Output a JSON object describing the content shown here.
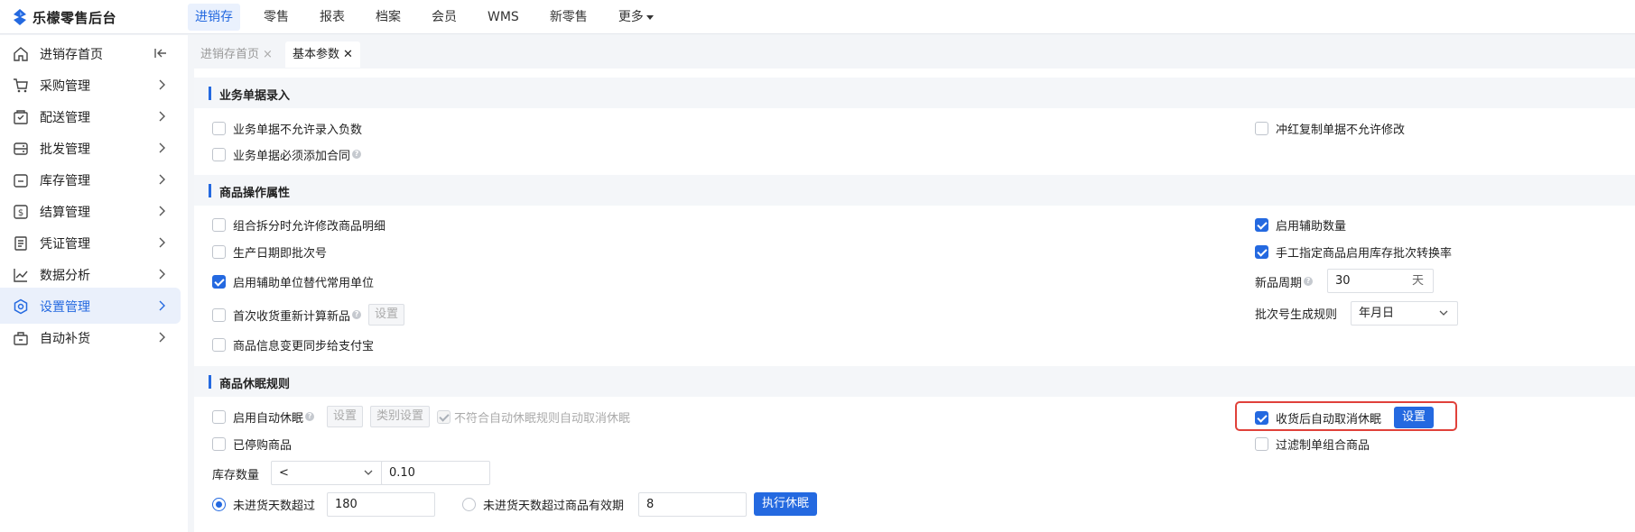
{
  "brand": {
    "name": "乐檬零售后台"
  },
  "nav": {
    "items": [
      {
        "label": "进销存",
        "active": true
      },
      {
        "label": "零售"
      },
      {
        "label": "报表"
      },
      {
        "label": "档案"
      },
      {
        "label": "会员"
      },
      {
        "label": "WMS"
      },
      {
        "label": "新零售"
      },
      {
        "label": "更多"
      }
    ]
  },
  "sidebar": {
    "items": [
      {
        "label": "进销存首页",
        "icon": "home-icon"
      },
      {
        "label": "采购管理",
        "icon": "cart-icon"
      },
      {
        "label": "配送管理",
        "icon": "delivery-icon"
      },
      {
        "label": "批发管理",
        "icon": "wholesale-icon"
      },
      {
        "label": "库存管理",
        "icon": "inventory-icon"
      },
      {
        "label": "结算管理",
        "icon": "settlement-icon"
      },
      {
        "label": "凭证管理",
        "icon": "voucher-icon"
      },
      {
        "label": "数据分析",
        "icon": "analytics-icon"
      },
      {
        "label": "设置管理",
        "icon": "settings-icon",
        "active": true
      },
      {
        "label": "自动补货",
        "icon": "replenish-icon"
      }
    ]
  },
  "tabs": [
    {
      "label": "进销存首页",
      "close": "×",
      "active": false
    },
    {
      "label": "基本参数",
      "close": "✕",
      "active": true
    }
  ],
  "sections": {
    "doc_entry": {
      "title": "业务单据录入",
      "opt_no_negative": {
        "label": "业务单据不允许录入负数",
        "checked": false
      },
      "opt_must_contract": {
        "label": "业务单据必须添加合同",
        "checked": false
      },
      "opt_red_copy": {
        "label": "冲红复制单据不允许修改",
        "checked": false
      }
    },
    "product_ops": {
      "title": "商品操作属性",
      "opt_split_modify": {
        "label": "组合拆分时允许修改商品明细",
        "checked": false
      },
      "opt_date_batch": {
        "label": "生产日期即批次号",
        "checked": false
      },
      "opt_aux_unit": {
        "label": "启用辅助单位替代常用单位",
        "checked": true
      },
      "opt_first_receive": {
        "label": "首次收货重新计算新品",
        "checked": false
      },
      "opt_first_receive_btn": "设置",
      "opt_alipay_sync": {
        "label": "商品信息变更同步给支付宝",
        "checked": false
      },
      "opt_aux_qty": {
        "label": "启用辅助数量",
        "checked": true
      },
      "opt_batch_rate": {
        "label": "手工指定商品启用库存批次转换率",
        "checked": true
      },
      "new_cycle_label": "新品周期",
      "new_cycle_value": "30",
      "new_cycle_unit": "天",
      "batch_rule_label": "批次号生成规则",
      "batch_rule_value": "年月日"
    },
    "dormancy": {
      "title": "商品休眠规则",
      "opt_auto_dormancy": {
        "label": "启用自动休眠",
        "checked": false
      },
      "btn_setting": "设置",
      "btn_category_setting": "类别设置",
      "opt_auto_cancel": {
        "label": "不符合自动休眠规则自动取消休眠",
        "checked": true,
        "disabled": true
      },
      "opt_stopped": {
        "label": "已停购商品",
        "checked": false
      },
      "stock_label": "库存数量",
      "stock_operator": "<",
      "stock_value": "0.10",
      "radio_days": {
        "label": "未进货天数超过",
        "checked": true
      },
      "days_value": "180",
      "radio_expiry": {
        "label": "未进货天数超过商品有效期",
        "checked": false
      },
      "expiry_value": "8",
      "btn_execute": "执行休眠",
      "opt_receive_cancel": {
        "label": "收货后自动取消休眠",
        "checked": true
      },
      "btn_receive_setting": "设置",
      "opt_filter_combo": {
        "label": "过滤制单组合商品",
        "checked": false
      }
    }
  },
  "colors": {
    "accent": "#2469e0",
    "highlight": "#e0413a"
  }
}
